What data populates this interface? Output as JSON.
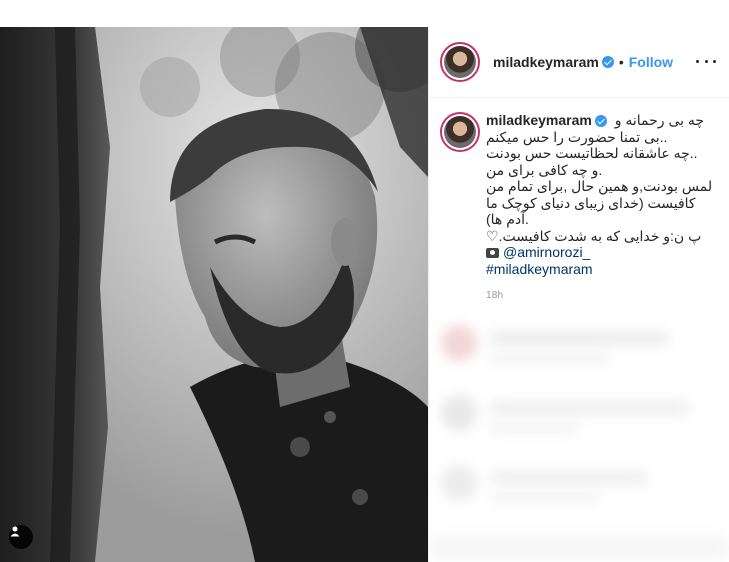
{
  "post": {
    "author": {
      "username": "miladkeymaram",
      "follow_label": "Follow",
      "separator": "•"
    },
    "caption": {
      "lines": [
        "چه بی رحمانه و",
        "..بی تمنا حضورت را حس میکنم",
        "..چه عاشقانه لحظاتیست حس بودنت",
        ".و چه کافی برای من",
        "لمس بودنت,و همین حال ,برای تمام من",
        "کافیست (خدای زیبای دنیای کوچک ما",
        ".آدم ها)",
        "پ ن:و خدایی که به شدت کافیست.♡"
      ],
      "photo_credit": "@amirnorozi_",
      "hashtag": "#miladkeymaram"
    },
    "timestamp": "18h"
  },
  "icons": {
    "verified": "verified-badge-icon",
    "more": "more-options-icon",
    "camera": "camera-icon",
    "tag": "user-tag-icon"
  },
  "colors": {
    "accent": "#3897f0",
    "link": "#003569",
    "story_ring": "#c6316e"
  }
}
